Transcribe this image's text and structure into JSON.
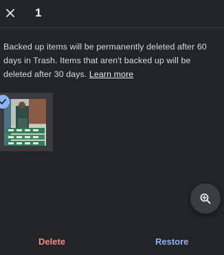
{
  "header": {
    "close_icon": "close-icon",
    "selected_count": "1"
  },
  "notice": {
    "text": "Backed up items will be permanently deleted after 60 days in Trash. Items that aren't backed up will be deleted after 30 days.",
    "learn_more": "Learn more"
  },
  "selection": {
    "check_icon": "check-circle-icon",
    "check_color": "#8ab4f8"
  },
  "zoom": {
    "icon": "zoom-in-icon"
  },
  "actions": {
    "delete_label": "Delete",
    "delete_color": "#f28b82",
    "restore_label": "Restore",
    "restore_color": "#8ab4f8"
  }
}
